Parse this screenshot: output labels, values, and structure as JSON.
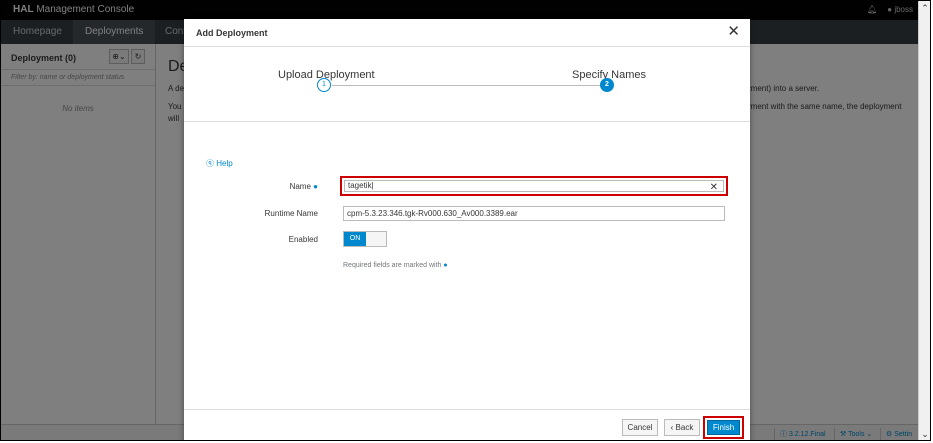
{
  "app": {
    "brand_bold": "HAL",
    "brand_rest": " Management Console",
    "user": "jboss"
  },
  "nav": {
    "items": [
      "Homepage",
      "Deployments",
      "Conf"
    ]
  },
  "sidebar": {
    "title": "Deployment (0)",
    "filter_placeholder": "Filter by: name or deployment status",
    "empty_text": "No items"
  },
  "background": {
    "title": "De",
    "line1_left": "A de",
    "line1_right": "ployment) into a server.",
    "line2_left": "You",
    "line2_right": "ployment with the same name, the deployment",
    "line3_left": "will"
  },
  "footer": {
    "version": "3.2.12.Final",
    "tools": "Tools",
    "settings": "Settin"
  },
  "modal": {
    "title": "Add Deployment",
    "steps": [
      {
        "label": "Upload Deployment",
        "number": "1"
      },
      {
        "label": "Specify Names",
        "number": "2"
      }
    ],
    "help": "Help",
    "fields": {
      "name_label": "Name",
      "name_value": "tagetik",
      "runtime_label": "Runtime Name",
      "runtime_value": "cpm-5.3.23.346.tgk-Rv000.630_Av000.3389.ear",
      "enabled_label": "Enabled",
      "enabled_value": "ON"
    },
    "required_note": "Required fields are marked with",
    "buttons": {
      "cancel": "Cancel",
      "back": "‹ Back",
      "finish": "Finish"
    }
  }
}
